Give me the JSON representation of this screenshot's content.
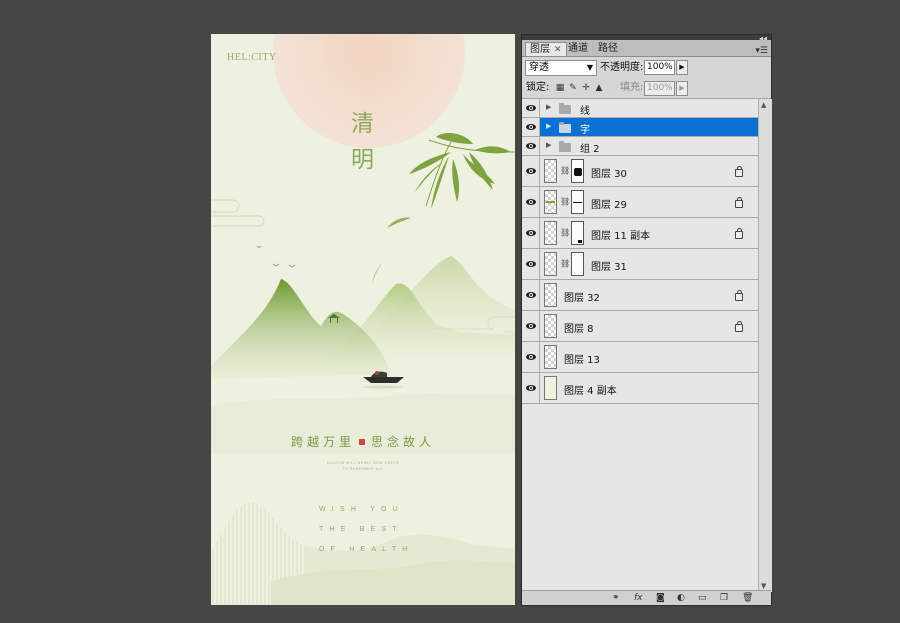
{
  "poster": {
    "brand": "HEL:CITY",
    "title_line1": "清",
    "title_line2": "明",
    "subtitle_left": "跨越万里",
    "subtitle_right": "思念故人",
    "tiny_line1": "SEASON WILL BRING NEW GREEN",
    "tiny_line2": "TO REMEMBER ALL",
    "wish_line1": "WISH YOU",
    "wish_line2": "THE BEST",
    "wish_line3": "OF HEALTH",
    "colors": {
      "background": "#eef1e0",
      "sun": "#f1d8c6",
      "mountain_dark": "#6f9a35",
      "mountain_light": "#b9cf8c",
      "accent_red": "#c94b3b"
    }
  },
  "layers_panel": {
    "tabs": [
      {
        "label": "图层",
        "active": true
      },
      {
        "label": "通道",
        "active": false
      },
      {
        "label": "路径",
        "active": false
      }
    ],
    "blend_mode": "穿透",
    "opacity_label": "不透明度:",
    "opacity_value": "100%",
    "lock_label": "锁定:",
    "fill_label": "填充:",
    "fill_value": "100%",
    "layers": [
      {
        "name": "线",
        "type": "group",
        "selected": false
      },
      {
        "name": "字",
        "type": "group",
        "selected": true
      },
      {
        "name": "组 2",
        "type": "group",
        "selected": false
      },
      {
        "name": "图层 30",
        "type": "masked",
        "locked": true
      },
      {
        "name": "图层 29",
        "type": "masked",
        "locked": true
      },
      {
        "name": "图层 11 副本",
        "type": "masked",
        "locked": true
      },
      {
        "name": "图层 31",
        "type": "masked",
        "locked": false
      },
      {
        "name": "图层 32",
        "type": "plain",
        "locked": true
      },
      {
        "name": "图层 8",
        "type": "plain",
        "locked": true
      },
      {
        "name": "图层 13",
        "type": "plain",
        "locked": false
      },
      {
        "name": "图层 4 副本",
        "type": "plain",
        "locked": false
      }
    ],
    "bottom_icons": [
      "link-icon",
      "fx-icon",
      "mask-icon",
      "adjustment-icon",
      "folder-icon",
      "new-layer-icon",
      "trash-icon"
    ]
  }
}
